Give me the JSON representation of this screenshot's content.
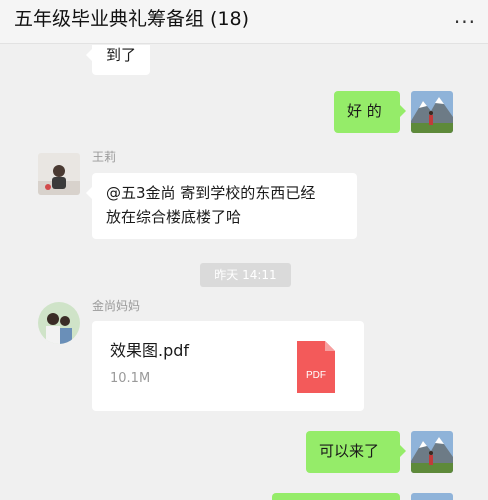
{
  "header": {
    "title": "五年级毕业典礼筹备组 (18)",
    "more_label": "..."
  },
  "messages": {
    "m0_text": "到了",
    "m1_text": "好 的",
    "m2_sender": "王莉",
    "m2_line1": "@五3金尚 寄到学校的东西已经",
    "m2_line2": "放在综合楼底楼了哈",
    "timestamp": "昨天 14:11",
    "m3_sender": "金尚妈妈",
    "m4_text": "可以来了"
  },
  "file": {
    "name": "效果图.pdf",
    "size": "10.1M",
    "icon_label": "PDF",
    "icon": "pdf-file-icon"
  },
  "colors": {
    "background": "#f0f0f0",
    "outgoing_bubble": "#95ec69",
    "incoming_bubble": "#ffffff",
    "pdf_red": "#f35a5a"
  }
}
